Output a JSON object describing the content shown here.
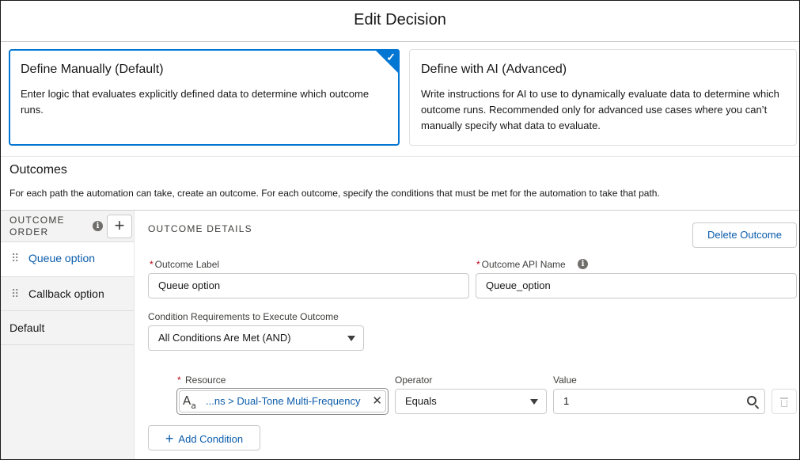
{
  "dialog": {
    "title": "Edit Decision"
  },
  "choices": [
    {
      "title": "Define Manually (Default)",
      "description": "Enter logic that evaluates explicitly defined data to determine which outcome runs.",
      "selected": true
    },
    {
      "title": "Define with AI (Advanced)",
      "description": "Write instructions for AI to use to dynamically evaluate data to determine which outcome runs. Recommended only for advanced use cases where you can’t manually specify what data to evaluate.",
      "selected": false
    }
  ],
  "outcomes": {
    "heading": "Outcomes",
    "description": "For each path the automation can take, create an outcome. For each outcome, specify the conditions that must be met for the automation to take that path.",
    "order_label_1": "OUTCOME",
    "order_label_2": "ORDER",
    "items": [
      {
        "label": "Queue option",
        "active": true
      },
      {
        "label": "Callback option",
        "active": false
      },
      {
        "label": "Default",
        "active": false
      }
    ]
  },
  "details": {
    "section_label": "OUTCOME DETAILS",
    "delete_label": "Delete Outcome",
    "outcome_label_label": "Outcome Label",
    "outcome_label_value": "Queue option",
    "api_name_label": "Outcome API Name",
    "api_name_value": "Queue_option",
    "condition_req_label": "Condition Requirements to Execute Outcome",
    "condition_req_value": "All Conditions Are Met (AND)",
    "required_marker": "*",
    "condition": {
      "resource_label": "Resource",
      "resource_value": "...ns > Dual-Tone Multi-Frequency",
      "operator_label": "Operator",
      "operator_value": "Equals",
      "value_label": "Value",
      "value_value": "1"
    },
    "add_condition_label": "Add Condition"
  },
  "colors": {
    "brand": "#0176d3",
    "link": "#0b5cab",
    "required": "#ba0517"
  },
  "icons": [
    "checkmark-icon",
    "info-icon",
    "plus-icon",
    "drag-handle-icon",
    "text-type-icon",
    "clear-icon",
    "chevron-down-icon",
    "search-icon",
    "trash-icon"
  ]
}
